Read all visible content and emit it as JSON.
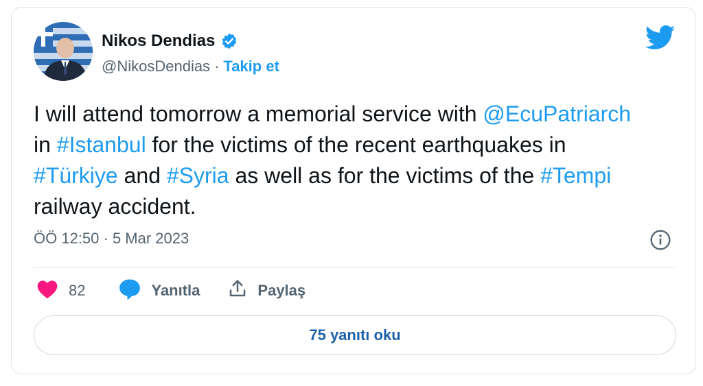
{
  "author": {
    "name": "Nikos Dendias",
    "handle": "@NikosDendias",
    "separator": "·",
    "follow_label": "Takip et"
  },
  "tweet": {
    "segments": [
      {
        "text": "I will attend tomorrow a memorial service with ",
        "link": false
      },
      {
        "text": "@EcuPatriarch",
        "link": true
      },
      {
        "text": " in ",
        "link": false
      },
      {
        "text": "#Istanbul",
        "link": true
      },
      {
        "text": " for the victims of the recent earthquakes in ",
        "link": false
      },
      {
        "text": "#Türkiye",
        "link": true
      },
      {
        "text": " and ",
        "link": false
      },
      {
        "text": "#Syria",
        "link": true
      },
      {
        "text": " as well as for the victims of the ",
        "link": false
      },
      {
        "text": "#Tempi",
        "link": true
      },
      {
        "text": " railway accident.",
        "link": false
      }
    ],
    "timestamp": "ÖÖ 12:50 · 5 Mar 2023"
  },
  "actions": {
    "like_count": "82",
    "reply_label": "Yanıtla",
    "share_label": "Paylaş"
  },
  "replies_button_label": "75 yanıtı oku",
  "icons": {
    "like": "heart-icon",
    "reply": "speech-bubble-icon",
    "share": "share-icon",
    "info": "info-icon",
    "verified": "verified-badge-icon",
    "brand": "twitter-bird-icon"
  },
  "colors": {
    "accent": "#1d9bf0",
    "like": "#f91880",
    "muted": "#536471",
    "text": "#0f1419"
  }
}
